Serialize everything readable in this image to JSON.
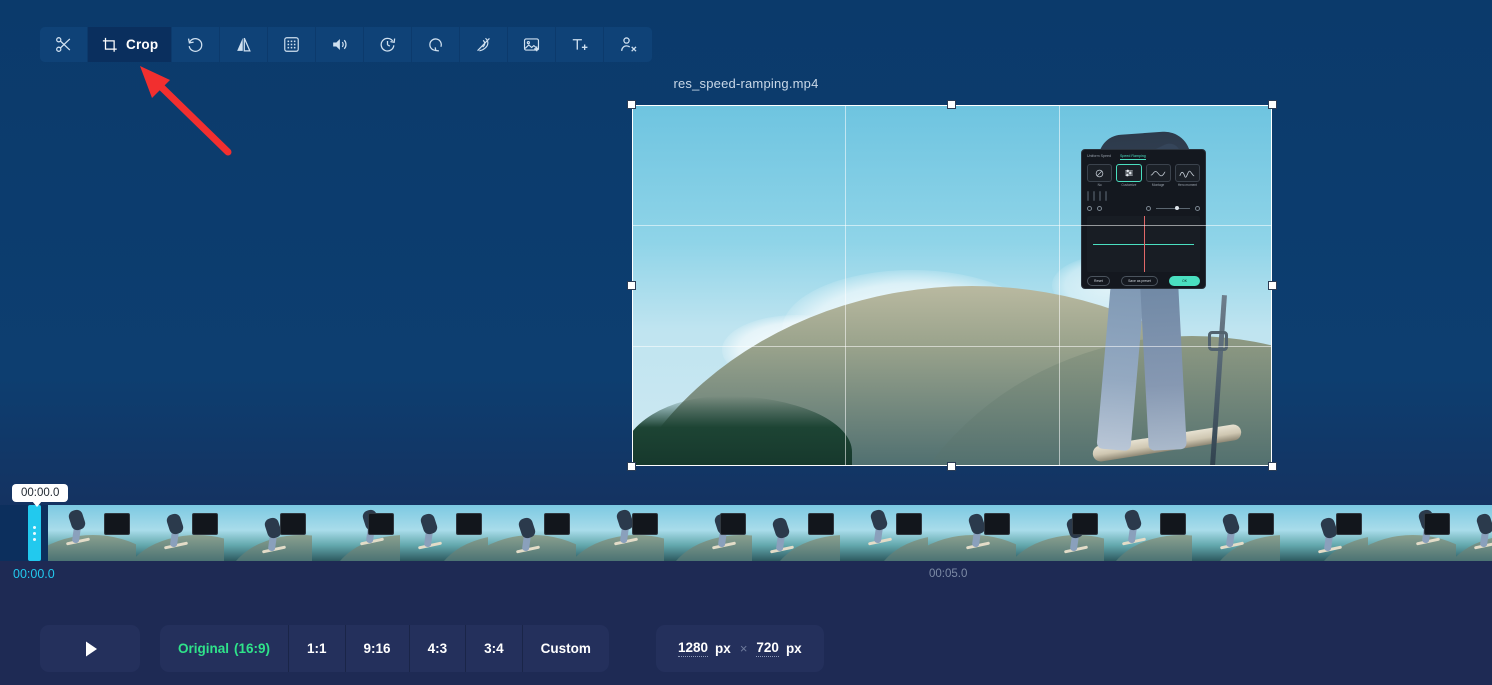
{
  "toolbar": {
    "buttons": [
      {
        "name": "cut",
        "icon": "scissors-icon",
        "label": ""
      },
      {
        "name": "crop",
        "icon": "crop-icon",
        "label": "Crop",
        "active": true
      },
      {
        "name": "rotate",
        "icon": "rotate-icon",
        "label": ""
      },
      {
        "name": "flip",
        "icon": "flip-icon",
        "label": ""
      },
      {
        "name": "mosaic",
        "icon": "mosaic-icon",
        "label": ""
      },
      {
        "name": "volume",
        "icon": "volume-icon",
        "label": ""
      },
      {
        "name": "speed",
        "icon": "speed-icon",
        "label": ""
      },
      {
        "name": "loop",
        "icon": "loop-icon",
        "label": ""
      },
      {
        "name": "denoise",
        "icon": "wave-hand-icon",
        "label": ""
      },
      {
        "name": "add-image",
        "icon": "image-add-icon",
        "label": ""
      },
      {
        "name": "add-text",
        "icon": "text-add-icon",
        "label": ""
      },
      {
        "name": "remove-person",
        "icon": "person-remove-icon",
        "label": ""
      }
    ]
  },
  "preview": {
    "file_title": "res_speed-ramping.mp4",
    "video_panel": {
      "tabs": [
        "Uniform Speed",
        "Speed Ramping"
      ],
      "active_tab": "Speed Ramping",
      "presets": [
        "No",
        "Customize",
        "Montage",
        "Hero moment"
      ],
      "selected_preset": "Customize",
      "buttons": [
        "Reset",
        "Save as preset",
        "OK"
      ]
    }
  },
  "timeline": {
    "tooltip_time": "00:00.0",
    "start_time": "00:00.0",
    "mid_time": "00:05.0",
    "thumb_count": 17
  },
  "bottom": {
    "play_label": "",
    "ratios": [
      {
        "label": "Original",
        "sub": "(16:9)",
        "selected": true
      },
      {
        "label": "1:1",
        "sub": "",
        "selected": false
      },
      {
        "label": "9:16",
        "sub": "",
        "selected": false
      },
      {
        "label": "4:3",
        "sub": "",
        "selected": false
      },
      {
        "label": "3:4",
        "sub": "",
        "selected": false
      },
      {
        "label": "Custom",
        "sub": "",
        "selected": false
      }
    ],
    "dimensions": {
      "width": "1280",
      "width_unit": "px",
      "separator": "×",
      "height": "720",
      "height_unit": "px"
    }
  },
  "colors": {
    "background": "#0b3a6b",
    "bottom_bar": "#1e2a54",
    "accent_green": "#2fe38a",
    "accent_cyan": "#22c9ee",
    "arrow_red": "#f22f2f",
    "panel_teal": "#4adfc0"
  }
}
